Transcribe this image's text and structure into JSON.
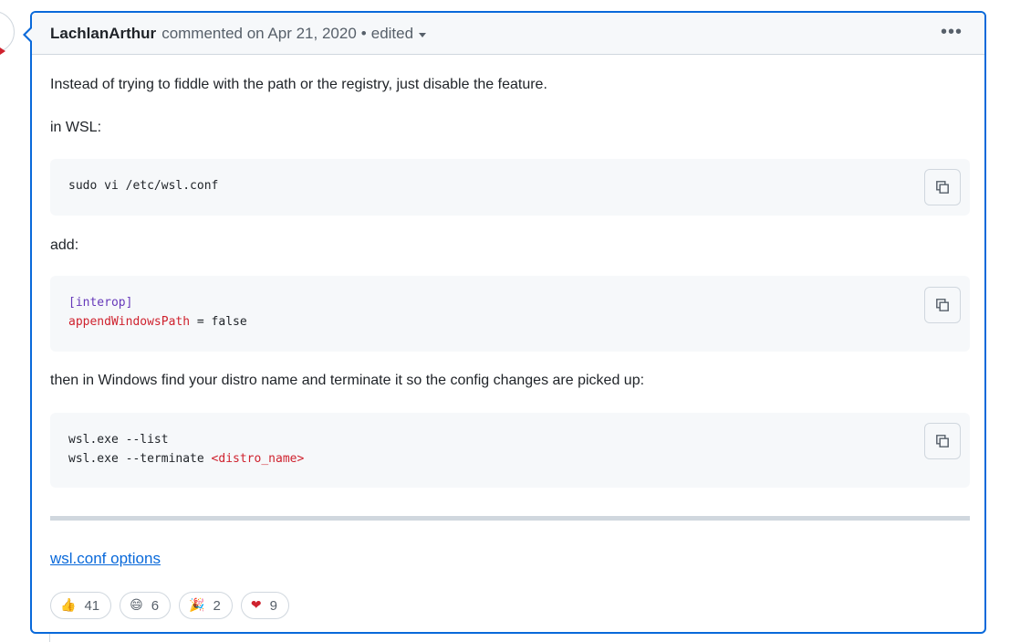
{
  "comment": {
    "author": "LachlanArthur",
    "action": "commented on Apr 21, 2020",
    "separator": "•",
    "edited": "edited",
    "menu_glyph": "•••"
  },
  "body": {
    "p1": "Instead of trying to fiddle with the path or the registry, just disable the feature.",
    "p2": "in WSL:",
    "code1": [
      "sudo vi /etc/wsl.conf"
    ],
    "p3": "add:",
    "code2": {
      "section": "[interop]",
      "key": "appendWindowsPath",
      "rest": " = false"
    },
    "p4": "then in Windows find your distro name and terminate it so the config changes are picked up:",
    "code3": {
      "line1": "wsl.exe --list",
      "line2_prefix": "wsl.exe --terminate ",
      "line2_arg": "<distro_name>"
    },
    "link": "wsl.conf options"
  },
  "reactions": [
    {
      "emoji": "👍",
      "count": "41"
    },
    {
      "emoji": "😄",
      "count": "6"
    },
    {
      "emoji": "🎉",
      "count": "2"
    },
    {
      "emoji": "❤",
      "count": "9"
    }
  ],
  "icons": {
    "copy": "copy-icon",
    "kebab": "kebab-menu-icon",
    "chevron": "chevron-down-icon"
  },
  "colors": {
    "accent": "#0969da",
    "border": "#d0d7de",
    "code_bg": "#f6f8fa",
    "keyword": "#6639ba",
    "key": "#cf222e"
  }
}
